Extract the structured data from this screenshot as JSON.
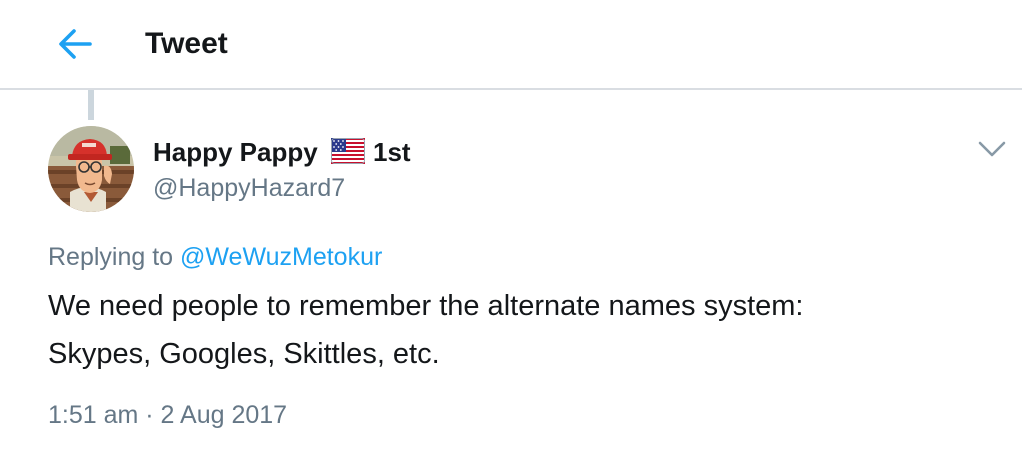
{
  "header": {
    "back_icon": "arrow-left-icon",
    "title": "Tweet"
  },
  "tweet": {
    "author": {
      "display_name": "Happy Pappy",
      "flag_icon": "us-flag-icon",
      "name_suffix": "1st",
      "handle": "@HappyHazard7",
      "avatar_icon": "cartoon-avatar-red-cap"
    },
    "menu_icon": "chevron-down-icon",
    "replying_prefix": "Replying to",
    "replying_to": "@WeWuzMetokur",
    "text_lines": [
      "We need people to remember the alternate names system:",
      "Skypes, Googles, Skittles, etc."
    ],
    "timestamp": "1:51 am · 2 Aug 2017"
  },
  "colors": {
    "accent": "#1da1f2",
    "text_primary": "#14171a",
    "text_secondary": "#657786",
    "divider": "#d9dde2"
  }
}
